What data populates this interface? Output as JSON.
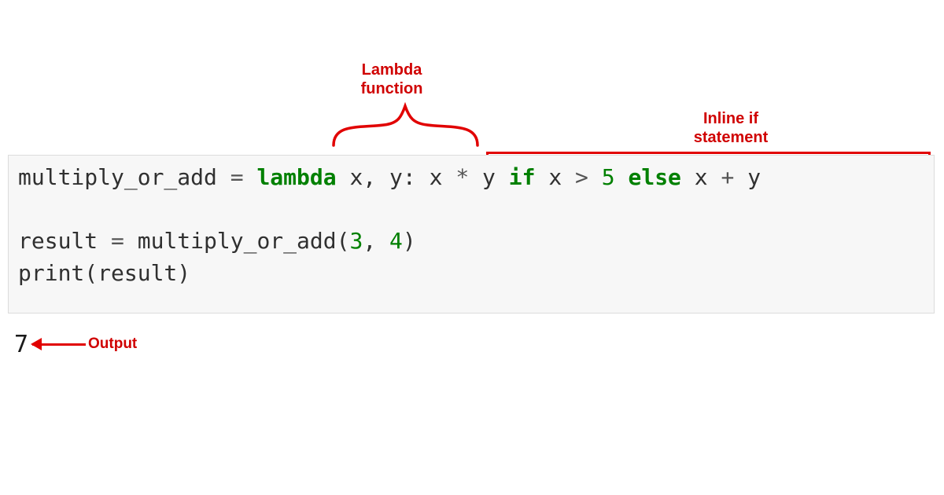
{
  "annotations": {
    "lambda": "Lambda function",
    "inline_if": "Inline if statement",
    "output": "Output"
  },
  "code": {
    "line1": {
      "t1": "multiply_or_add ",
      "eq": "=",
      "sp1": " ",
      "lambda": "lambda",
      "t2": " x, y: x ",
      "star": "*",
      "t3": " y ",
      "if": "if",
      "t4": " x ",
      "gt": ">",
      "sp2": " ",
      "five": "5",
      "sp3": " ",
      "else": "else",
      "t5": " x ",
      "plus": "+",
      "t6": " y"
    },
    "line2": "",
    "line3": {
      "t1": "result ",
      "eq": "=",
      "t2": " multiply_or_add(",
      "n1": "3",
      "comma": ", ",
      "n2": "4",
      "paren": ")"
    },
    "line4": {
      "t1": "print(result)"
    }
  },
  "result": "7"
}
